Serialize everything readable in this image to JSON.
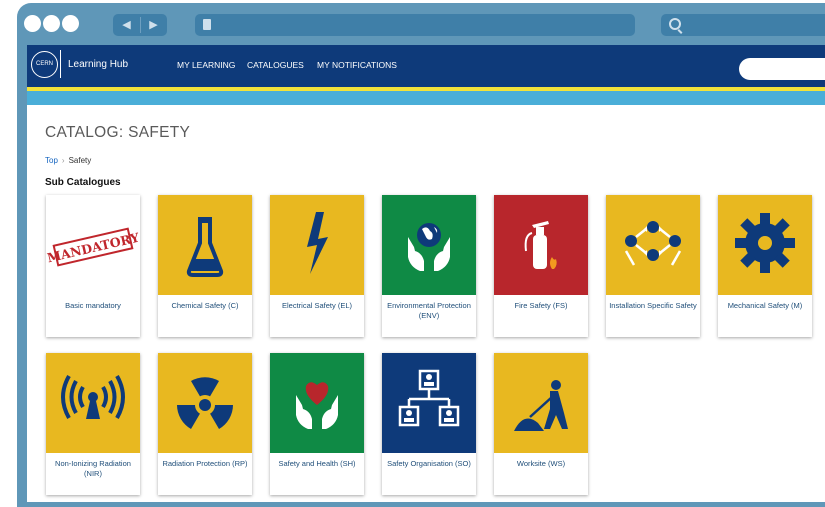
{
  "header": {
    "brand": "Learning Hub",
    "logo_text": "CERN",
    "menu": [
      "MY LEARNING",
      "CATALOGUES",
      "MY NOTIFICATIONS"
    ]
  },
  "page": {
    "title": "CATALOG: SAFETY",
    "breadcrumb": {
      "top": "Top",
      "separator": "›",
      "current": "Safety"
    },
    "subcatalogues_heading": "Sub Catalogues"
  },
  "catalogues": [
    {
      "label": "Basic mandatory",
      "icon": "mandatory-stamp-icon",
      "bg": "#ffffff",
      "stamp": "MANDATORY"
    },
    {
      "label": "Chemical Safety (C)",
      "icon": "flask-icon",
      "bg": "#e8b820"
    },
    {
      "label": "Electrical Safety (EL)",
      "icon": "lightning-icon",
      "bg": "#e8b820"
    },
    {
      "label": "Environmental Protection (ENV)",
      "icon": "globe-hands-icon",
      "bg": "#0f8a45"
    },
    {
      "label": "Fire Safety (FS)",
      "icon": "fire-extinguisher-icon",
      "bg": "#b8262c"
    },
    {
      "label": "Installation Specific Safety",
      "icon": "installation-cycle-icon",
      "bg": "#e8b820"
    },
    {
      "label": "Mechanical Safety (M)",
      "icon": "gear-icon",
      "bg": "#e8b820"
    },
    {
      "label": "Non-Ionizing Radiation (NIR)",
      "icon": "radio-waves-icon",
      "bg": "#e8b820"
    },
    {
      "label": "Radiation Protection (RP)",
      "icon": "radiation-icon",
      "bg": "#e8b820"
    },
    {
      "label": "Safety and Health (SH)",
      "icon": "heart-hands-icon",
      "bg": "#0f8a45"
    },
    {
      "label": "Safety Organisation (SO)",
      "icon": "org-chart-icon",
      "bg": "#0e3a7a"
    },
    {
      "label": "Worksite (WS)",
      "icon": "worker-shovel-icon",
      "bg": "#e8b820"
    }
  ],
  "colors": {
    "header": "#0e3a7a",
    "accent_yellow": "#f2e23a",
    "teal": "#4aaed8",
    "frame": "#5f97b8",
    "icon_dark": "#0e3a7a"
  }
}
